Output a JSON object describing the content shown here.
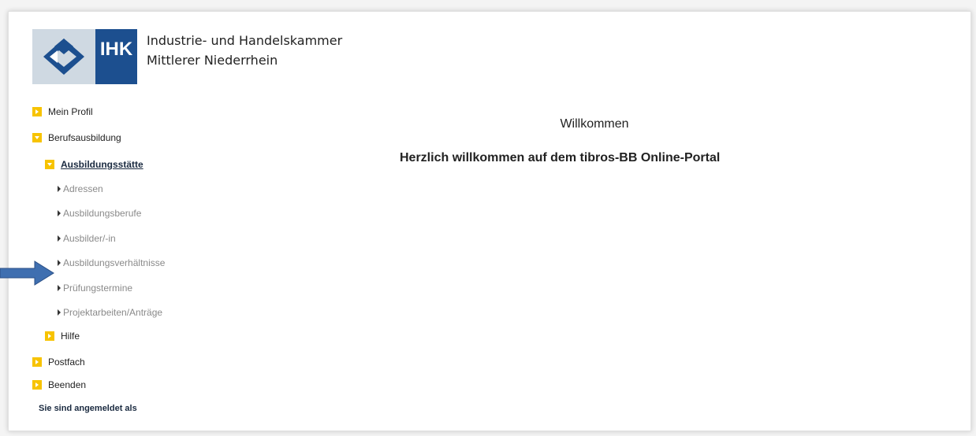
{
  "header": {
    "logo_text": "IHK",
    "org_line1": "Industrie- und Handelskammer",
    "org_line2": "Mittlerer Niederrhein"
  },
  "nav": {
    "mein_profil": "Mein Profil",
    "berufsausbildung": "Berufsausbildung",
    "ausbildungsstaette": "Ausbildungsstätte",
    "sub": [
      "Adressen",
      "Ausbildungsberufe",
      "Ausbilder/-in",
      "Ausbildungsverhältnisse",
      "Prüfungstermine",
      "Projektarbeiten/Anträge"
    ],
    "hilfe": "Hilfe",
    "postfach": "Postfach",
    "beenden": "Beenden"
  },
  "session": {
    "label": "Sie sind angemeldet als"
  },
  "main": {
    "title": "Willkommen",
    "greeting": "Herzlich willkommen auf dem tibros-BB Online-Portal"
  },
  "colors": {
    "accent_yellow": "#f7c300",
    "ihk_blue": "#1c4f8f",
    "arrow_blue": "#3f6fb0"
  }
}
